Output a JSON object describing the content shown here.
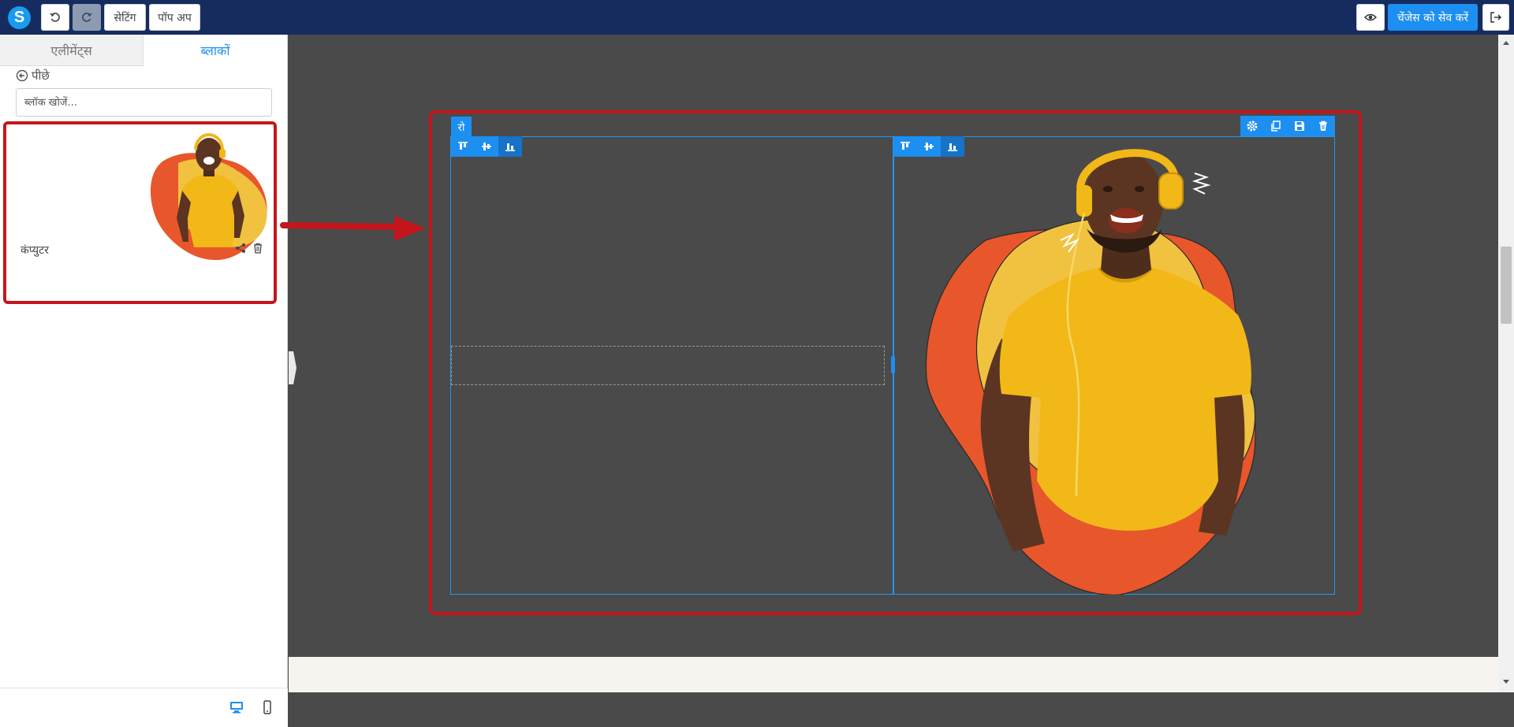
{
  "topbar": {
    "logo": "S",
    "undo_icon": "undo-icon",
    "redo_icon": "redo-icon",
    "settings_label": "सेटिंग",
    "popup_label": "पॉप अप",
    "preview_icon": "eye-icon",
    "save_label": "चेंजेस को सेव करें",
    "exit_icon": "exit-icon"
  },
  "sidebar": {
    "tabs": [
      "एलीमेंट्स",
      "ब्लाकों"
    ],
    "active_tab": "ब्लाकों",
    "back_label": "पीछे",
    "search_placeholder": "ब्लॉक खोजें...",
    "block_card": {
      "label": "कंप्युटर",
      "icons": [
        "share-icon",
        "trash-icon"
      ]
    },
    "device_icons": [
      "desktop-icon",
      "mobile-icon"
    ]
  },
  "canvas": {
    "row_tag": "रो",
    "row_tools": [
      "gear-icon",
      "copy-icon",
      "save-icon",
      "trash-icon"
    ],
    "column_align_tools": [
      "align-top-icon",
      "align-middle-icon",
      "align-bottom-icon"
    ]
  },
  "colors": {
    "topbar": "#162c5f",
    "accent": "#1c8ff0",
    "highlight": "#c4161c",
    "canvas": "#4a4a4a",
    "blob_orange": "#e8562b",
    "blob_yellow": "#f1c23f",
    "shirt": "#f2b817"
  }
}
